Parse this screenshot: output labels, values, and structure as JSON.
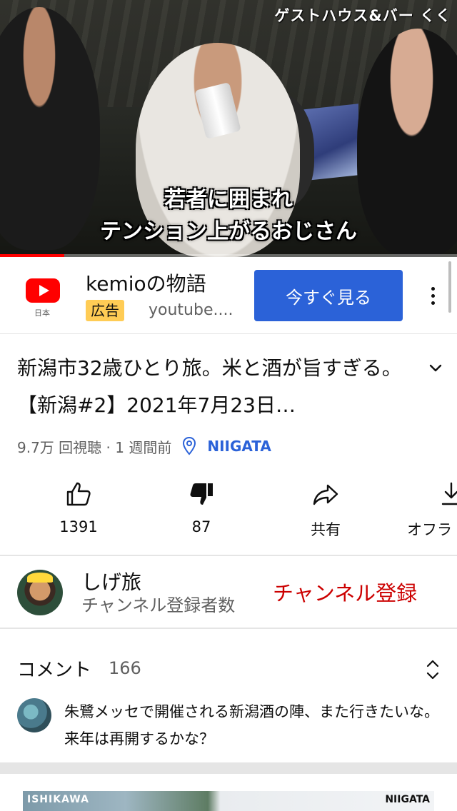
{
  "player": {
    "corner_label": "ゲストハウス&バー くく",
    "subtitle_line1": "若者に囲まれ",
    "subtitle_line2": "テンション上がるおじさん",
    "progress_fraction": 0.14,
    "progress_color": "#ff0000"
  },
  "ad": {
    "logo_icon": "youtube-logo-icon",
    "logo_caption": "日本",
    "advertiser": "kemioの物語",
    "badge": "広告",
    "domain": "youtube....",
    "cta_label": "今すぐ見る",
    "cta_color": "#2b62d8"
  },
  "video": {
    "title": "新潟市32歳ひとり旅。米と酒が旨すぎる。【新潟#2】2021年7月23日…",
    "meta": "9.7万 回視聴 · 1 週間前",
    "location": "NIIGATA"
  },
  "actions": {
    "like": "1391",
    "dislike": "87",
    "share": "共有",
    "offline": "オフラ"
  },
  "channel": {
    "name": "しげ旅",
    "subscribers_label": "チャンネル登録者数",
    "subscribe_label": "チャンネル登録",
    "subscribe_color": "#cc0000"
  },
  "comments": {
    "header": "コメント",
    "count": "166",
    "top_comment": "朱鷺メッセで開催される新潟酒の陣、また行きたいな。来年は再開するかな？"
  },
  "next_video": {
    "thumb_left_label": "ISHIKAWA",
    "thumb_right_label": "NIIGATA"
  }
}
